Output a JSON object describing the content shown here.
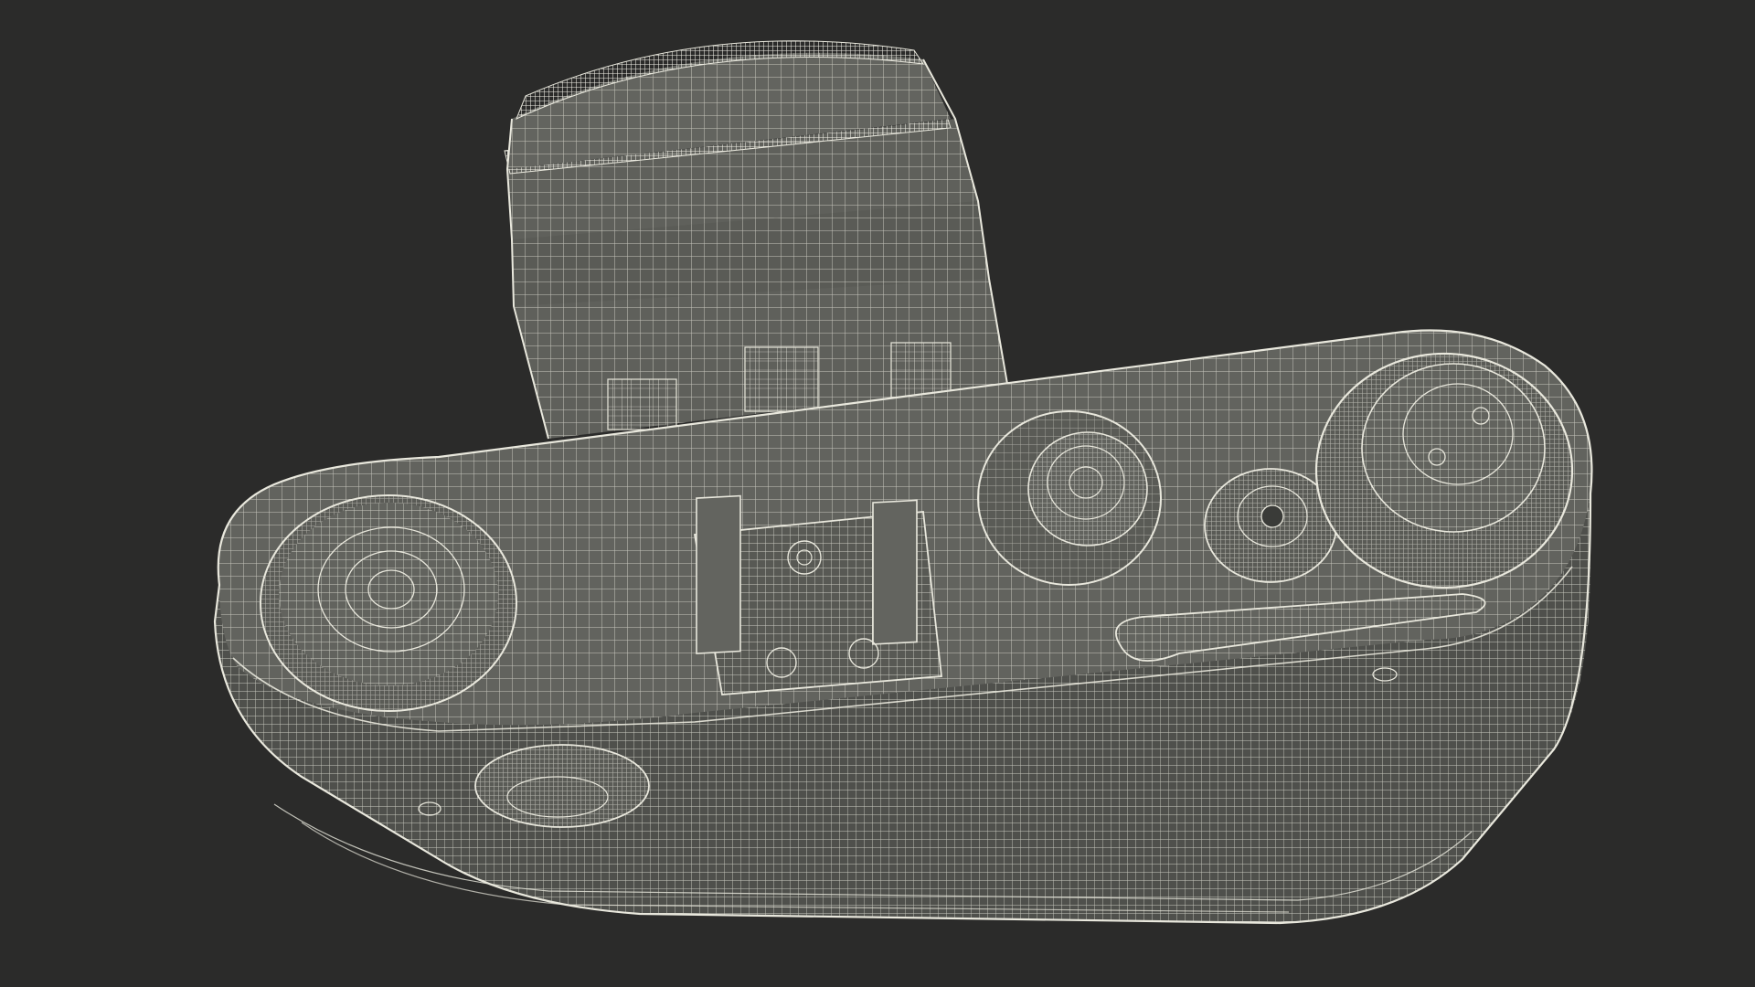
{
  "scene": {
    "subject": "rangefinder-camera",
    "render_style": "wireframe",
    "colors": {
      "background": "#2b2b2a",
      "surface": "#5f605b",
      "surface_shadow": "#4d4e4a",
      "wire": "#e9e8dd"
    }
  }
}
